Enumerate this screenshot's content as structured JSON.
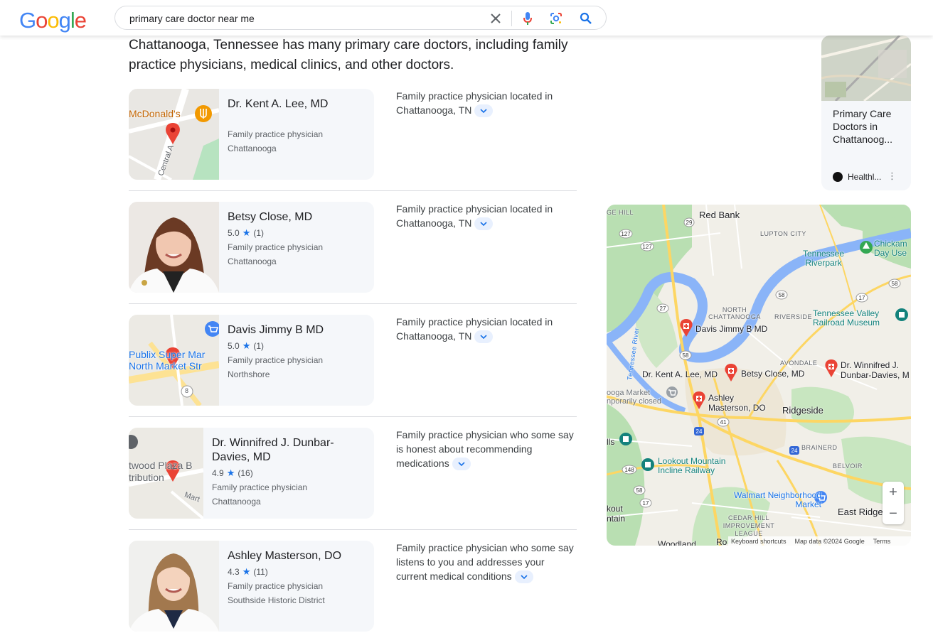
{
  "header": {
    "logo": "Google",
    "search_query": "primary care doctor near me"
  },
  "intro": "Chattanooga, Tennessee has many primary care doctors, including family practice physicians, medical clinics, and other doctors.",
  "results": [
    {
      "name": "Dr. Kent A. Lee, MD",
      "rating": "",
      "reviews": "",
      "specialty": "Family practice physician",
      "location": "Chattanooga",
      "description": "Family practice physician located in Chattanooga, TN",
      "thumb_labels": [
        "McDonald's",
        "Central A"
      ]
    },
    {
      "name": "Betsy Close, MD",
      "rating": "5.0",
      "reviews": "(1)",
      "specialty": "Family practice physician",
      "location": "Chattanooga",
      "description": "Family practice physician located in Chattanooga, TN",
      "thumb_labels": []
    },
    {
      "name": "Davis Jimmy B MD",
      "rating": "5.0",
      "reviews": "(1)",
      "specialty": "Family practice physician",
      "location": "Northshore",
      "description": "Family practice physician located in Chattanooga, TN",
      "thumb_labels": [
        "Publix Super Mar",
        "North Market Str",
        "8"
      ]
    },
    {
      "name": "Dr. Winnifred J. Dunbar-Davies, MD",
      "rating": "4.9",
      "reviews": "(16)",
      "specialty": "Family practice physician",
      "location": "Chattanooga",
      "description": "Family practice physician who some say is honest about recommending medications",
      "thumb_labels": [
        "twood Plaza B",
        "tribution",
        "Mart"
      ]
    },
    {
      "name": "Ashley Masterson, DO",
      "rating": "4.3",
      "reviews": "(11)",
      "specialty": "Family practice physician",
      "location": "Southside Historic District",
      "description": "Family practice physician who some say listens to you and addresses your current medical conditions",
      "thumb_labels": []
    }
  ],
  "side_card": {
    "title": "Primary Care Doctors in Chattanoog...",
    "source": "Healthl...",
    "more": "⋮"
  },
  "map": {
    "places": [
      {
        "text": "Red Bank"
      },
      {
        "text": "LUPTON CITY"
      },
      {
        "text": "Tennessee Riverpark"
      },
      {
        "text": "Chickam Day Use"
      },
      {
        "text": "NORTH CHATTANOOGA"
      },
      {
        "text": "RIVERSIDE"
      },
      {
        "text": "Tennessee Valley Railroad Museum"
      },
      {
        "text": "AVONDALE"
      },
      {
        "text": "Ridgeside"
      },
      {
        "text": "BRAINERD"
      },
      {
        "text": "BELVOIR"
      },
      {
        "text": "Lookout Mountain Incline Railway"
      },
      {
        "text": "Walmart Neighborhood Market"
      },
      {
        "text": "East Ridge"
      },
      {
        "text": "CEDAR HILL IMPROVEMENT LEAGUE"
      },
      {
        "text": "ooga Market nporarily closed"
      },
      {
        "text": "Tennessee River"
      },
      {
        "text": "GE HILL"
      },
      {
        "text": "lls"
      },
      {
        "text": "kout ntain"
      },
      {
        "text": "Woodland"
      },
      {
        "text": "Ro"
      }
    ],
    "pins": [
      {
        "text": "Davis Jimmy B MD"
      },
      {
        "text": "Dr. Kent A. Lee, MD"
      },
      {
        "text": "Betsy Close, MD"
      },
      {
        "text": "Dr. Winnifred J. Dunbar-Davies, M"
      },
      {
        "text": "Ashley Masterson, DO"
      }
    ],
    "shields": [
      "29",
      "127",
      "127",
      "58",
      "17",
      "58",
      "27",
      "58",
      "41",
      "24",
      "24",
      "148",
      "58",
      "17"
    ],
    "zoom_in": "+",
    "zoom_out": "−",
    "attribution": {
      "shortcuts": "Keyboard shortcuts",
      "data": "Map data ©2024 Google",
      "terms": "Terms"
    }
  },
  "colors": {
    "accent": "#1a73e8",
    "pin": "#ea4335",
    "card_bg": "#f5f7fa",
    "chip_bg": "#e8f0fe"
  }
}
